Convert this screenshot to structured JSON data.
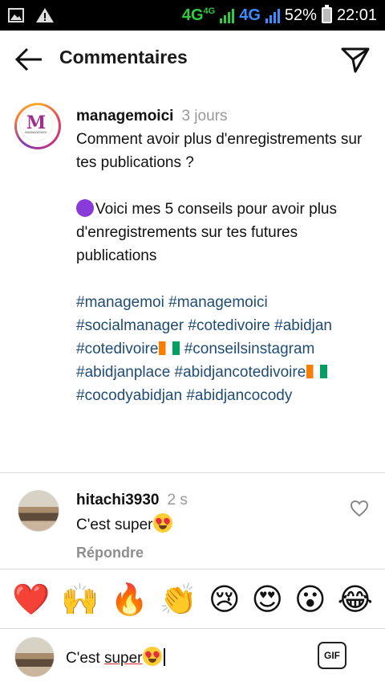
{
  "status_bar": {
    "network_label": "4G",
    "network_label_small": "4G",
    "network_label_2": "4G",
    "battery": "52%",
    "time": "22:01",
    "icons": [
      "image-icon",
      "warning-icon",
      "signal-icon",
      "battery-icon"
    ]
  },
  "header": {
    "title": "Commentaires",
    "back_icon": "arrow-left-icon",
    "send_icon": "paper-plane-icon"
  },
  "caption": {
    "username": "managemoici",
    "time": "3 jours",
    "line1": "Comment avoir plus d'enregistrements sur tes publications ?",
    "line2": "Voici mes 5 conseils pour avoir plus d'enregistrements sur tes futures publications",
    "hashtags": {
      "h1": "#managemoi",
      "h2": "#managemoici",
      "h3": "#socialmanager",
      "h4": "#cotedivoire",
      "h5": "#abidjan",
      "h6": "#cotedivoire",
      "h7": "#conseilsinstagram",
      "h8": "#abidjanplace",
      "h9": "#abidjancotedivoire",
      "h10": "#cocodyabidjan",
      "h11": "#abidjancocody"
    },
    "logo_text": "MANAGEMOI"
  },
  "comment": {
    "username": "hitachi3930",
    "time": "2 s",
    "text": "C'est super",
    "reply_label": "Répondre"
  },
  "reactions": [
    "❤️",
    "🙌",
    "🔥",
    "👏",
    "😢",
    "😍",
    "😮",
    "😂"
  ],
  "composer": {
    "text_prefix": "C'est ",
    "text_typo": "super",
    "gif_label": "GIF"
  },
  "colors": {
    "hashtag": "#1f4c77",
    "muted": "#999999",
    "status_bar_bg": "#000000"
  }
}
